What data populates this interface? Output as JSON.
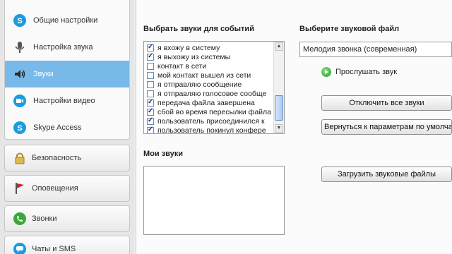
{
  "sidebar": {
    "sub_items": [
      {
        "label": "Общие настройки",
        "icon": "skype-icon"
      },
      {
        "label": "Настройка звука",
        "icon": "microphone-icon"
      },
      {
        "label": "Звуки",
        "icon": "speaker-icon",
        "active": true
      },
      {
        "label": "Настройки видео",
        "icon": "webcam-icon"
      },
      {
        "label": "Skype Access",
        "icon": "skype-icon"
      }
    ],
    "groups": [
      {
        "label": "Безопасность",
        "icon": "padlock-icon"
      },
      {
        "label": "Оповещения",
        "icon": "flag-icon"
      },
      {
        "label": "Звонки",
        "icon": "phone-icon"
      },
      {
        "label": "Чаты и SMS",
        "icon": "chat-icon"
      }
    ]
  },
  "events": {
    "title": "Выбрать звуки для событий",
    "items": [
      {
        "label": "я вхожу в систему",
        "checked": true
      },
      {
        "label": "я выхожу из системы",
        "checked": true
      },
      {
        "label": "контакт в сети",
        "checked": false
      },
      {
        "label": "мой контакт вышел из сети",
        "checked": false
      },
      {
        "label": "я отправляю сообщение",
        "checked": false
      },
      {
        "label": "я отправляю голосовое сообще",
        "checked": false
      },
      {
        "label": "передача файла завершена",
        "checked": true
      },
      {
        "label": "сбой во время пересылки файла",
        "checked": true
      },
      {
        "label": "пользователь присоединился к",
        "checked": true
      },
      {
        "label": "пользователь покинул конфере",
        "checked": true
      }
    ]
  },
  "sound_file": {
    "title": "Выберите звуковой файл",
    "selected": "Мелодия звонка (современная)",
    "play_label": "Прослушать звук",
    "disable_all_label": "Отключить все звуки",
    "reset_label": "Вернуться к параметрам по умолчан"
  },
  "my_sounds": {
    "title": "Мои звуки",
    "upload_label": "Загрузить звуковые файлы"
  }
}
